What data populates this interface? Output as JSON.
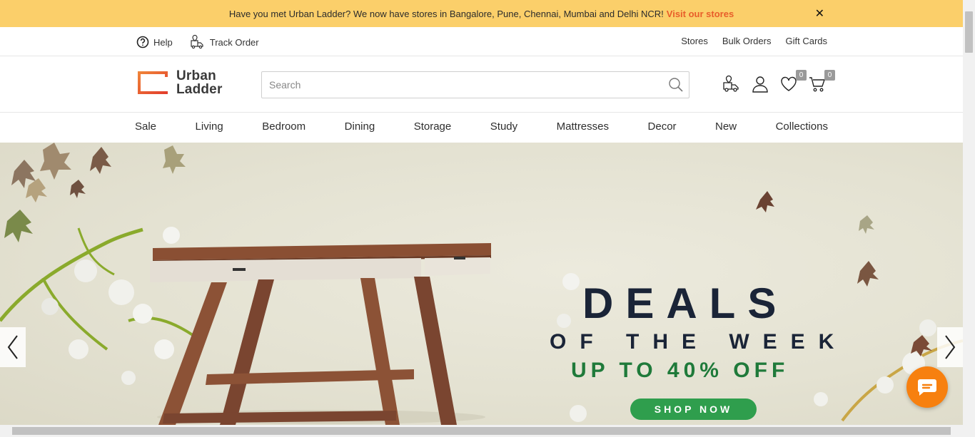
{
  "announcement": {
    "text": "Have you met Urban Ladder? We now have stores in Bangalore, Pune, Chennai, Mumbai and Delhi NCR!",
    "link": "Visit our stores",
    "close": "✕"
  },
  "utility": {
    "help": "Help",
    "track_order": "Track Order",
    "stores": "Stores",
    "bulk_orders": "Bulk Orders",
    "gift_cards": "Gift Cards"
  },
  "header": {
    "logo_line1": "Urban",
    "logo_line2": "Ladder",
    "search_placeholder": "Search",
    "wishlist_count": "0",
    "cart_count": "0"
  },
  "nav": {
    "items": [
      "Sale",
      "Living",
      "Bedroom",
      "Dining",
      "Storage",
      "Study",
      "Mattresses",
      "Decor",
      "New",
      "Collections"
    ]
  },
  "hero": {
    "title": "DEALS",
    "subtitle": "OF THE WEEK",
    "offer": "UP TO 40% OFF",
    "cta": "SHOP NOW"
  },
  "colors": {
    "announcement_bg": "#fbcf6a",
    "link": "#e85d2a",
    "logo_accent": "#e8532b",
    "hero_dark": "#1a2437",
    "hero_green": "#1f7a3a",
    "cta_bg": "#2f9e4d",
    "chat_bg": "#f7800f"
  }
}
